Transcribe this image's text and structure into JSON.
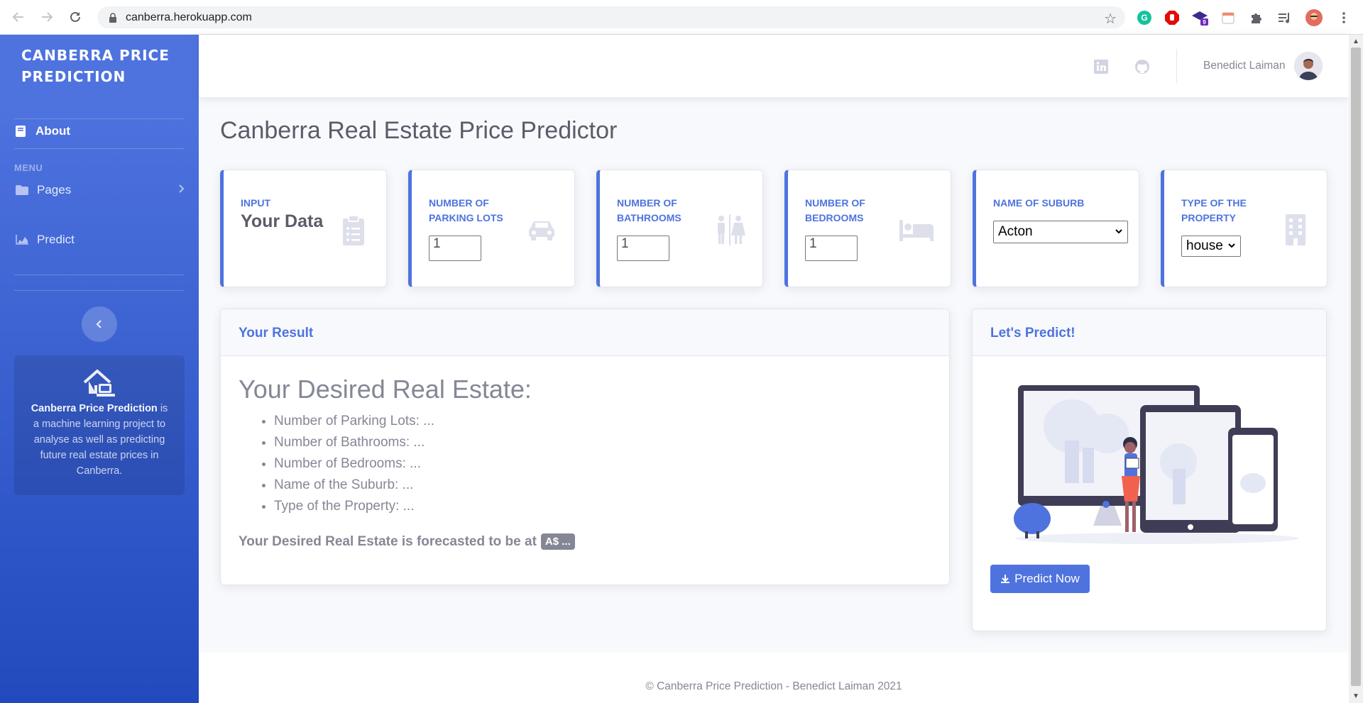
{
  "browser": {
    "url": "canberra.herokuapp.com",
    "extension_badge": "9",
    "icons": [
      "back-arrow-icon",
      "forward-arrow-icon",
      "reload-icon",
      "lock-icon",
      "star-icon",
      "grammarly-icon",
      "adblock-icon",
      "graduation-cap-icon",
      "calendar-icon",
      "puzzle-icon",
      "media-queue-icon",
      "profile-avatar-icon",
      "menu-dots-icon"
    ]
  },
  "sidebar": {
    "brand": "CANBERRA PRICE PREDICTION",
    "about_label": "About",
    "menu_heading": "MENU",
    "pages_label": "Pages",
    "predict_label": "Predict",
    "card": {
      "brand_bold": "Canberra Price Prediction",
      "text": "is a machine learning project to analyse as well as predicting future real estate prices in Canberra."
    },
    "colors": {
      "gradient_start": "#4e73df",
      "gradient_end": "#224abe"
    }
  },
  "topbar": {
    "user_name": "Benedict Laiman",
    "icons": [
      "linkedin-icon",
      "github-icon",
      "user-avatar"
    ]
  },
  "page": {
    "title": "Canberra Real Estate Price Predictor",
    "input_card": {
      "label": "INPUT",
      "value": "Your Data"
    },
    "parking": {
      "label": "NUMBER OF PARKING LOTS",
      "value": "1"
    },
    "bathrooms": {
      "label": "NUMBER OF BATHROOMS",
      "value": "1"
    },
    "bedrooms": {
      "label": "NUMBER OF BEDROOMS",
      "value": "1"
    },
    "suburb": {
      "label": "NAME OF SUBURB",
      "selected": "Acton"
    },
    "property_type": {
      "label": "TYPE OF THE PROPERTY",
      "selected": "house"
    }
  },
  "result": {
    "header": "Your Result",
    "title": "Your Desired Real Estate:",
    "items": [
      "Number of Parking Lots: ...",
      "Number of Bathrooms: ...",
      "Number of Bedrooms: ...",
      "Name of the Suburb: ...",
      "Type of the Property: ..."
    ],
    "forecast_text": "Your Desired Real Estate is forecasted to be at",
    "forecast_badge": "A$ ..."
  },
  "predict": {
    "header": "Let's Predict!",
    "button_label": "Predict Now"
  },
  "footer": {
    "text": "© Canberra Price Prediction - Benedict Laiman 2021"
  },
  "colors": {
    "primary": "#4e73df",
    "text": "#858796",
    "heading": "#5a5c69",
    "background": "#f8f9fc"
  }
}
